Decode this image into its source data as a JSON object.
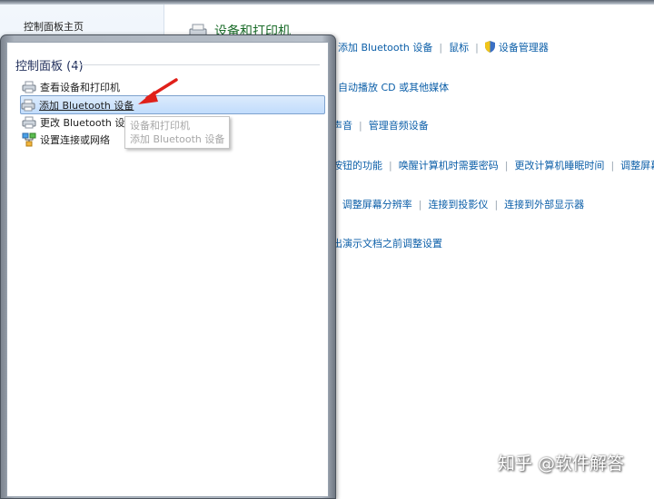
{
  "nav": {
    "home": "控制面板主页"
  },
  "category": {
    "title": "设备和打印机",
    "row1": [
      "添加 Bluetooth 设备",
      "鼠标",
      "设备管理器"
    ]
  },
  "content_rows": {
    "autoplay": "自动播放 CD 或其他媒体",
    "sound_a": "声音",
    "sound_b": "管理音频设备",
    "power": [
      "按钮的功能",
      "唤醒计算机时需要密码",
      "更改计算机睡眠时间",
      "调整屏幕"
    ],
    "display": [
      "调整屏幕分辨率",
      "连接到投影仪",
      "连接到外部显示器"
    ],
    "present": "出演示文档之前调整设置"
  },
  "popup": {
    "header": "控制面板 (4)",
    "items": [
      {
        "label": "查看设备和打印机",
        "icon": "printer-icon"
      },
      {
        "label": "添加 Bluetooth 设备",
        "icon": "printer-icon"
      },
      {
        "label": "更改 Bluetooth 设置",
        "icon": "printer-icon"
      },
      {
        "label": "设置连接或网络",
        "icon": "network-icon"
      }
    ],
    "tooltip": [
      "设备和打印机",
      "添加 Bluetooth 设备"
    ]
  },
  "watermark": "知乎 @软件解答",
  "colors": {
    "link": "#0b5ea8",
    "category_title": "#1b6c2a",
    "selection": "#c1dcfc",
    "arrow": "#e0201a"
  }
}
